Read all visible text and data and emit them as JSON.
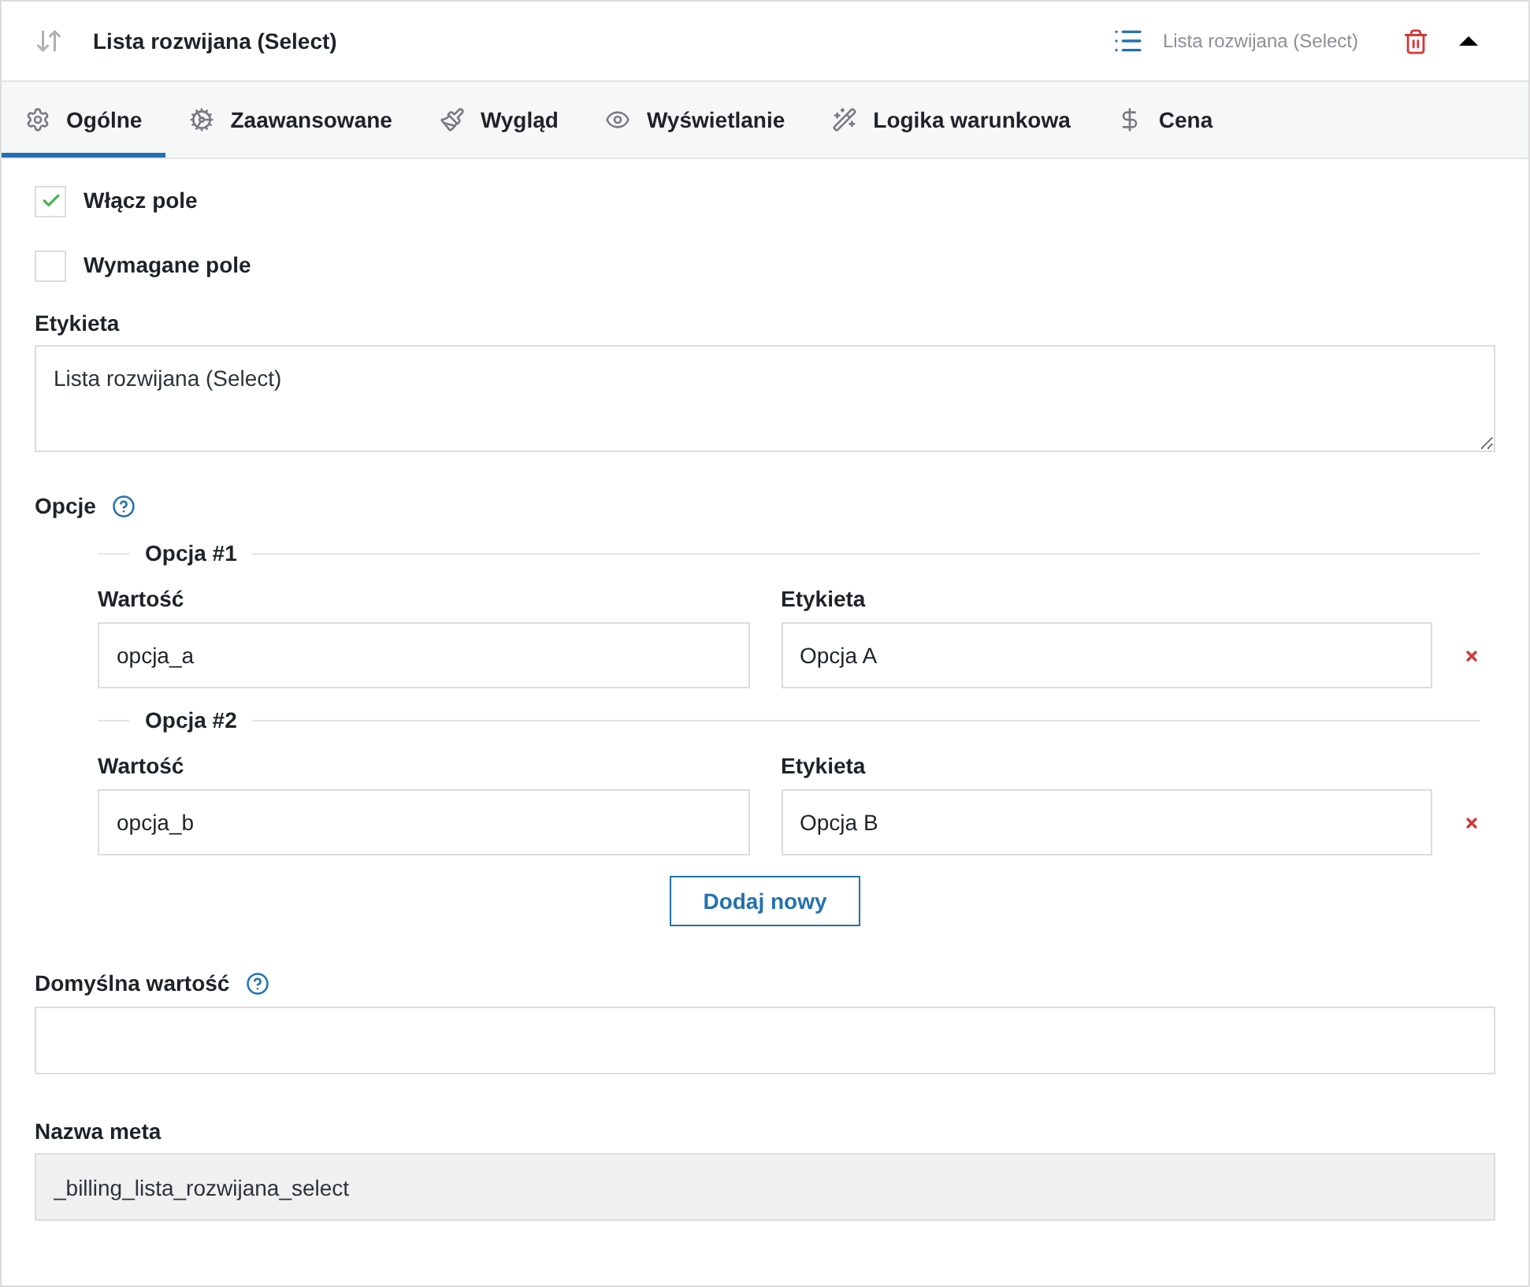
{
  "header": {
    "title": "Lista rozwijana (Select)",
    "type_label": "Lista rozwijana (Select)",
    "expanded": true
  },
  "tabs": [
    {
      "label": "Ogólne",
      "selected": true
    },
    {
      "label": "Zaawansowane",
      "selected": false
    },
    {
      "label": "Wygląd",
      "selected": false
    },
    {
      "label": "Wyświetlanie",
      "selected": false
    },
    {
      "label": "Logika warunkowa",
      "selected": false
    },
    {
      "label": "Cena",
      "selected": false
    }
  ],
  "checkboxes": [
    {
      "label": "Włącz pole",
      "checked": true
    },
    {
      "label": "Wymagane pole",
      "checked": false
    }
  ],
  "label_field": {
    "label": "Etykieta",
    "value": "Lista rozwijana (Select)"
  },
  "options": {
    "label": "Opcje",
    "items": [
      {
        "legend": "Opcja #1",
        "value_label": "Wartość",
        "value": "opcja_a",
        "label_label": "Etykieta",
        "label": "Opcja A"
      },
      {
        "legend": "Opcja #2",
        "value_label": "Wartość",
        "value": "opcja_b",
        "label_label": "Etykieta",
        "label": "Opcja B"
      }
    ],
    "add_button": "Dodaj nowy"
  },
  "default_value": {
    "label": "Domyślna wartość"
  },
  "meta_name": {
    "label": "Nazwa meta",
    "value": "_billing_lista_rozwijana_select",
    "disabled": true
  }
}
